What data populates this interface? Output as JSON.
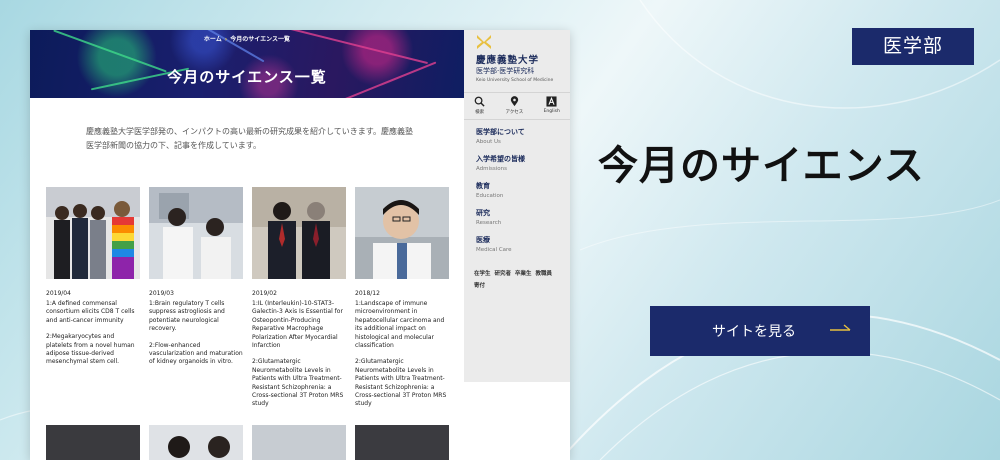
{
  "mockup": {
    "breadcrumb": {
      "home": "ホーム",
      "current": "今月のサイエンス一覧"
    },
    "hero_title": "今月のサイエンス一覧",
    "intro": "慶應義塾大学医学部発の、インパクトの高い最新の研究成果を紹介していきます。慶應義塾医学部新聞の協力の下、記事を作成しています。",
    "cards": [
      {
        "date": "2019/04",
        "items": [
          "1:A defined commensal consortium elicits CD8 T cells and anti-cancer immunity",
          "2:Megakaryocytes and platelets from a novel human adipose tissue-derived mesenchymal stem cell."
        ]
      },
      {
        "date": "2019/03",
        "items": [
          "1:Brain regulatory T cells suppress astrogliosis and potentiate neurological recovery.",
          "2:Flow-enhanced vascularization and maturation of kidney organoids in vitro."
        ]
      },
      {
        "date": "2019/02",
        "items": [
          "1:IL (Interleukin)-10-STAT3-Galectin-3 Axis Is Essential for Osteopontin-Producing Reparative Macrophage Polarization After Myocardial Infarction",
          "2:Glutamatergic Neurometabolite Levels in Patients with Ultra Treatment-Resistant Schizophrenia: a Cross-sectional 3T Proton MRS study"
        ]
      },
      {
        "date": "2018/12",
        "items": [
          "1:Landscape of immune microenvironment in hepatocellular carcinoma and its additional impact on histological and molecular classification",
          "2:Glutamatergic Neurometabolite Levels in Patients with Ultra Treatment-Resistant Schizophrenia: a Cross-sectional 3T Proton MRS study"
        ]
      }
    ],
    "side": {
      "logo_name": "慶應義塾大学",
      "logo_sub": "医学部·医学研究科",
      "logo_en": "Keio University School of Medicine",
      "icons": [
        {
          "label": "検索",
          "icon": "search-icon"
        },
        {
          "label": "アクセス",
          "icon": "map-pin-icon"
        },
        {
          "label": "English",
          "icon": "language-icon"
        }
      ],
      "nav": [
        {
          "jp": "医学部について",
          "en": "About Us"
        },
        {
          "jp": "入学希望の皆様",
          "en": "Admissions"
        },
        {
          "jp": "教育",
          "en": "Education"
        },
        {
          "jp": "研究",
          "en": "Research"
        },
        {
          "jp": "医療",
          "en": "Medical Care"
        }
      ],
      "links": [
        "在学生",
        "研究者",
        "卒業生",
        "教職員",
        "寄付"
      ]
    }
  },
  "badge": "医学部",
  "title": "今月のサイエンス",
  "cta": "サイトを見る",
  "colors": {
    "navy": "#1b2a6b",
    "gold": "#e8c040"
  }
}
